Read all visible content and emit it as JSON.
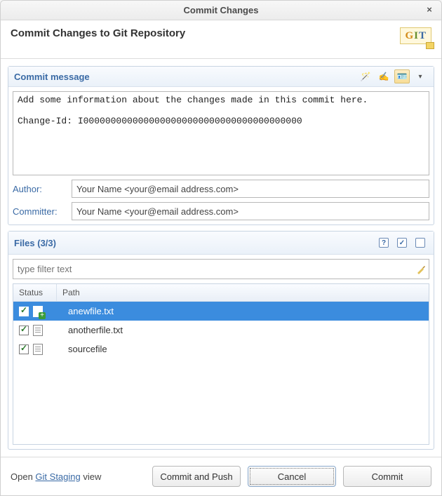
{
  "window": {
    "title": "Commit Changes"
  },
  "header": {
    "title": "Commit Changes to Git Repository",
    "logo_text": "GIT"
  },
  "commitPanel": {
    "title": "Commit message",
    "message": "Add some information about the changes made in this commit here.\n\nChange-Id: I0000000000000000000000000000000000000000",
    "authorLabel": "Author:",
    "authorValue": "Your Name <your@email address.com>",
    "committerLabel": "Committer:",
    "committerValue": "Your Name <your@email address.com>"
  },
  "filesPanel": {
    "title": "Files (3/3)",
    "filterPlaceholder": "type filter text",
    "columns": {
      "status": "Status",
      "path": "Path"
    },
    "rows": [
      {
        "path": "anewfile.txt",
        "checked": true,
        "added": true,
        "selected": true
      },
      {
        "path": "anotherfile.txt",
        "checked": true,
        "added": false,
        "selected": false
      },
      {
        "path": "sourcefile",
        "checked": true,
        "added": false,
        "selected": false
      }
    ]
  },
  "footer": {
    "open": "Open ",
    "link": "Git Staging",
    "view": " view",
    "commitPush": "Commit and Push",
    "cancel": "Cancel",
    "commit": "Commit"
  }
}
